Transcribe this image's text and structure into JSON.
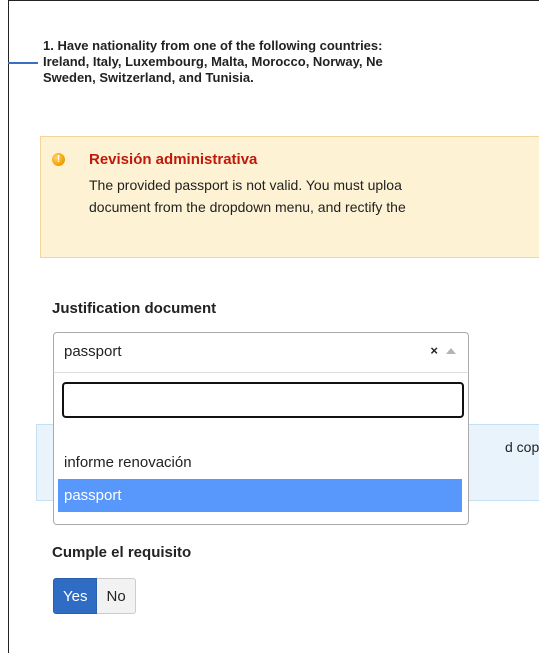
{
  "requirement": {
    "line1": "1. Have nationality from one of the following countries:",
    "line2": "Ireland, Italy, Luxembourg, Malta, Morocco, Norway, Ne",
    "line3": "Sweden, Switzerland, and Tunisia."
  },
  "alert": {
    "icon": "warning-icon",
    "icon_glyph": "!",
    "title": "Revisión administrativa",
    "line1": "The provided passport is not valid. You must uploa",
    "line2": "document from the dropdown menu, and rectify the"
  },
  "justification": {
    "label": "Justification document",
    "selected": "passport",
    "clear_glyph": "×",
    "search_value": "",
    "options": [
      {
        "label": "informe renovación",
        "selected": false
      },
      {
        "label": "passport",
        "selected": true
      }
    ]
  },
  "info_strip": {
    "visible_text": "d copy c"
  },
  "cumple": {
    "label": "Cumple el requisito",
    "yes": "Yes",
    "no": "No",
    "active": "Yes"
  },
  "colors": {
    "alert_bg": "#fdf2d4",
    "alert_title": "#c0190b",
    "highlight": "#5897fb",
    "toggle_active": "#2f6cc4"
  }
}
